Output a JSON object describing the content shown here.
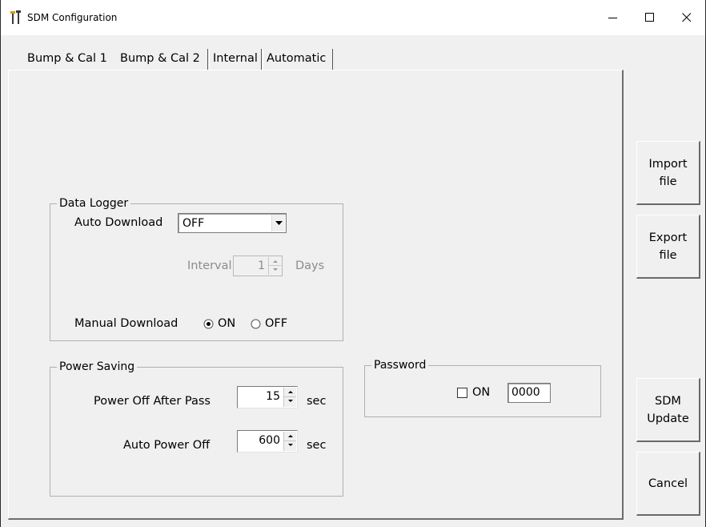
{
  "window": {
    "title": "SDM Configuration",
    "minimize_icon": "minimize-icon",
    "maximize_icon": "maximize-icon",
    "close_icon": "close-icon"
  },
  "tabs": [
    {
      "label": "Bump & Cal 1",
      "selected": false
    },
    {
      "label": "Bump & Cal 2",
      "selected": true
    },
    {
      "label": "Internal",
      "selected": false
    },
    {
      "label": "Automatic",
      "selected": false
    }
  ],
  "data_logger": {
    "title": "Data Logger",
    "auto_download_label": "Auto Download",
    "auto_download_value": "OFF",
    "interval_label": "Interval",
    "interval_value": "1",
    "interval_unit": "Days",
    "manual_download_label": "Manual Download",
    "on_label": "ON",
    "off_label": "OFF",
    "manual_download_selected": "ON"
  },
  "power_saving": {
    "title": "Power Saving",
    "power_off_after_pass_label": "Power Off After Pass",
    "power_off_after_pass_value": "15",
    "power_off_after_pass_unit": "sec",
    "auto_power_off_label": "Auto Power Off",
    "auto_power_off_value": "600",
    "auto_power_off_unit": "sec"
  },
  "password": {
    "title": "Password",
    "on_label": "ON",
    "checked": false,
    "value": "0000"
  },
  "buttons": {
    "import": "Import\nfile",
    "export": "Export\nfile",
    "sdm_update": "SDM\nUpdate",
    "cancel": "Cancel"
  }
}
